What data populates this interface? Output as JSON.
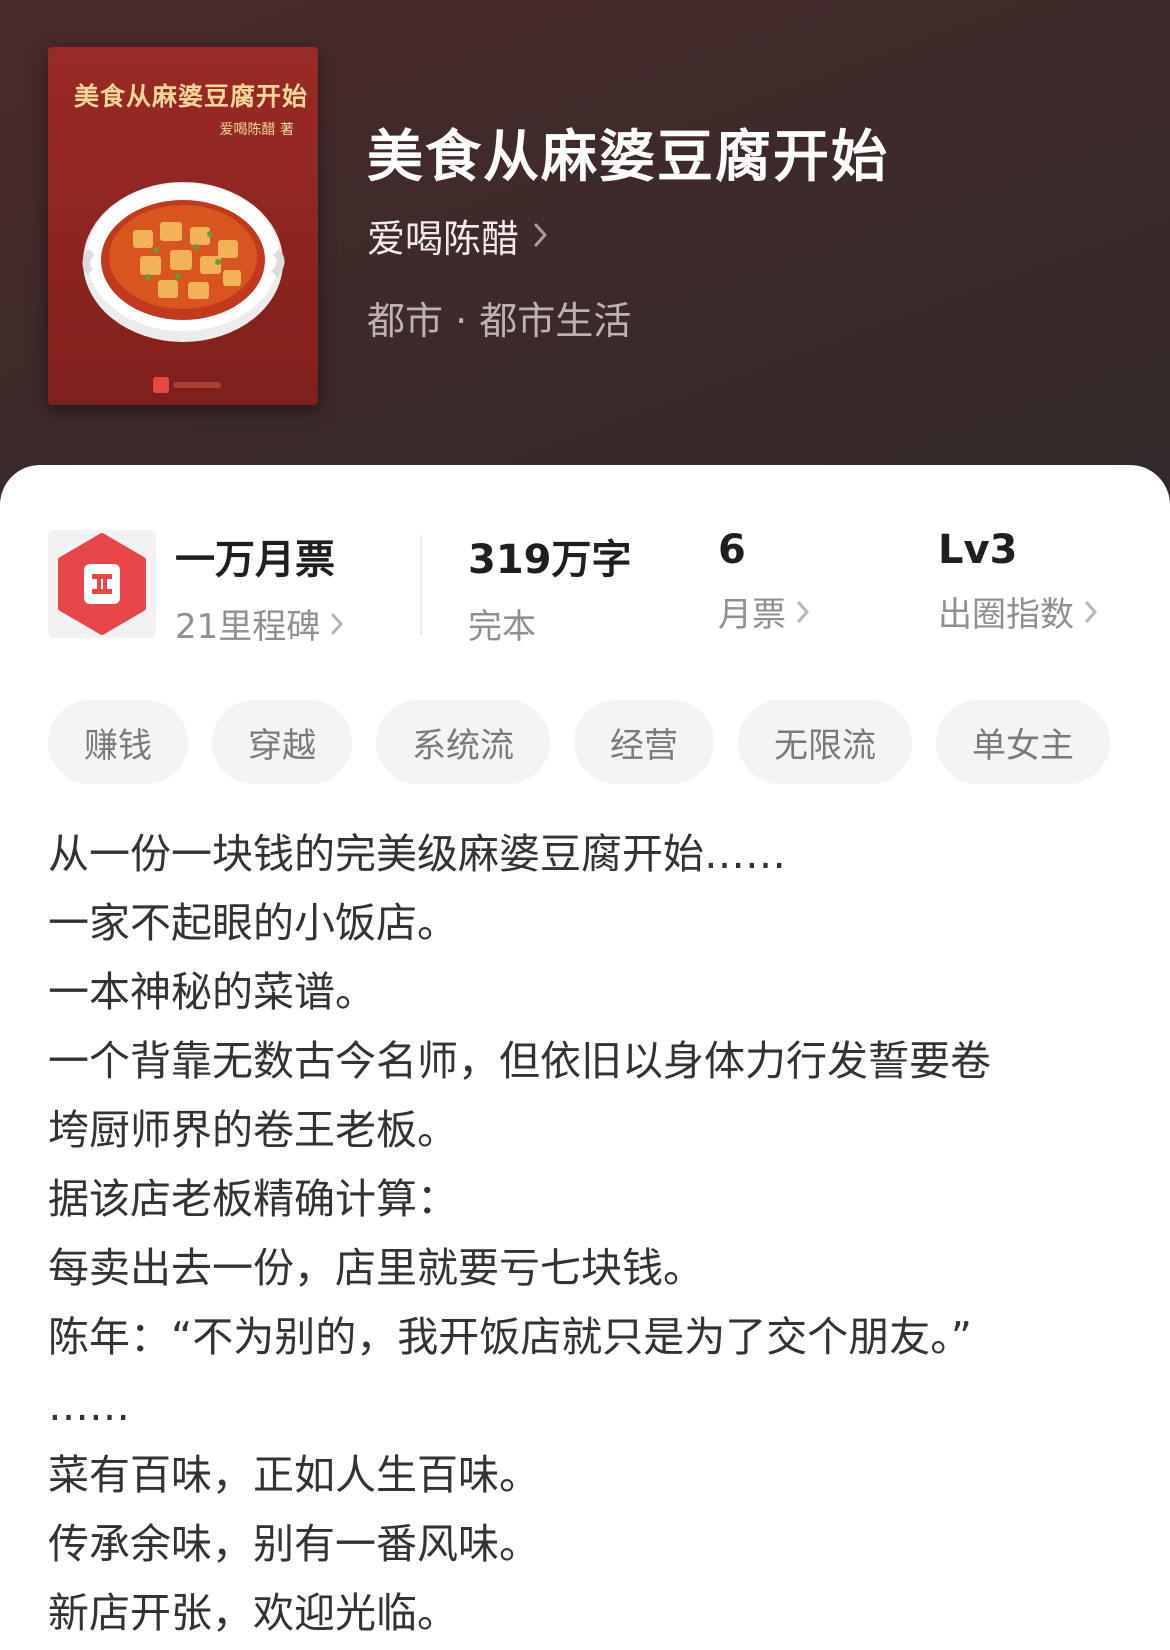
{
  "book": {
    "title": "美食从麻婆豆腐开始",
    "author": "爱喝陈醋",
    "genre": "都市 · 都市生活",
    "cover": {
      "title": "美食从麻婆豆腐开始",
      "author_line": "爱喝陈醋 著"
    }
  },
  "stats": {
    "monthly_ticket_title": "一万月票",
    "milestones": "21里程碑",
    "word_count": "319万字",
    "status": "完本",
    "ticket_count": "6",
    "ticket_label": "月票",
    "level": "Lv3",
    "level_label": "出圈指数"
  },
  "tags": [
    "赚钱",
    "穿越",
    "系统流",
    "经营",
    "无限流",
    "单女主"
  ],
  "description": [
    "从一份一块钱的完美级麻婆豆腐开始……",
    "一家不起眼的小饭店。",
    "一本神秘的菜谱。",
    "一个背靠无数古今名师，但依旧以身体力行发誓要卷",
    "垮厨师界的卷王老板。",
    "据该店老板精确计算：",
    "每卖出去一份，店里就要亏七块钱。",
    "陈年：“不为别的，我开饭店就只是为了交个朋友。”",
    "……",
    "菜有百味，正如人生百味。",
    "传承余味，别有一番风味。",
    "新店开张，欢迎光临。"
  ],
  "colors": {
    "header_bg": "#3e2a2a",
    "cover_red": "#8c2420",
    "ticket_icon_red": "#e8474a",
    "tag_bg": "#f4f4f4"
  }
}
